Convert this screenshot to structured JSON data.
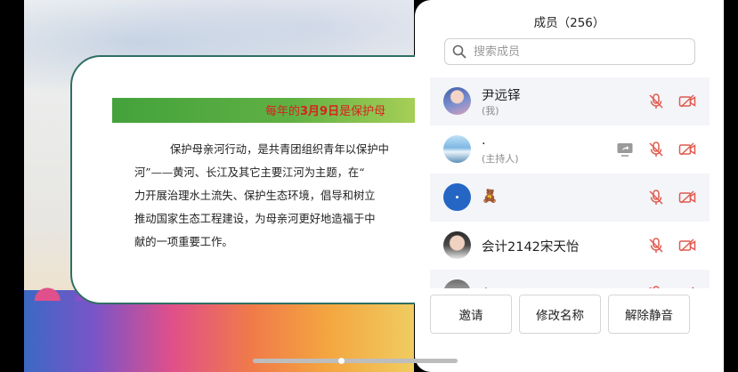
{
  "slide": {
    "heading_pre": "每年的",
    "heading_highlight": "3月9日",
    "heading_post": "是保护母",
    "lines": [
      "保护母亲河行动，是共青团组织青年以保护中",
      "河”——黄河、长江及其它主要江河为主题，在“",
      "力开展治理水土流失、保护生态环境，倡导和树立",
      "推动国家生态工程建设，为母亲河更好地造福于中",
      "献的一项重要工作。"
    ]
  },
  "panel": {
    "title": "成员（256）",
    "search_placeholder": "搜索成员",
    "members": [
      {
        "name": "尹远铎",
        "role": "(我)",
        "avatar_icon": "avatar-anime-icon",
        "mic": "mic-muted-icon",
        "cam": "camera-off-icon"
      },
      {
        "name": ".",
        "role": "(主持人)",
        "avatar_icon": "avatar-sky-icon",
        "share": "screen-share-icon",
        "mic": "mic-muted-icon",
        "cam": "camera-off-icon"
      },
      {
        "name": "🧸",
        "role": "",
        "avatar_icon": "avatar-blue-icon",
        "mic": "mic-muted-icon",
        "cam": "camera-off-icon"
      },
      {
        "name": "会计2142宋天怡",
        "role": "",
        "avatar_icon": "avatar-photo-icon",
        "mic": "mic-muted-icon",
        "cam": "camera-off-icon"
      },
      {
        "name": "鲁熙",
        "role": "",
        "avatar_icon": "avatar-group-icon",
        "mic": "mic-muted-icon",
        "cam": "camera-off-icon"
      }
    ],
    "buttons": {
      "invite": "邀请",
      "rename": "修改名称",
      "unmute": "解除静音"
    }
  },
  "colors": {
    "muted_red": "#e05a4f",
    "icon_gray": "#9a9a9a",
    "slide_green": "#44a23c",
    "heading_red": "#d82020",
    "card_border": "#2f6f63"
  }
}
